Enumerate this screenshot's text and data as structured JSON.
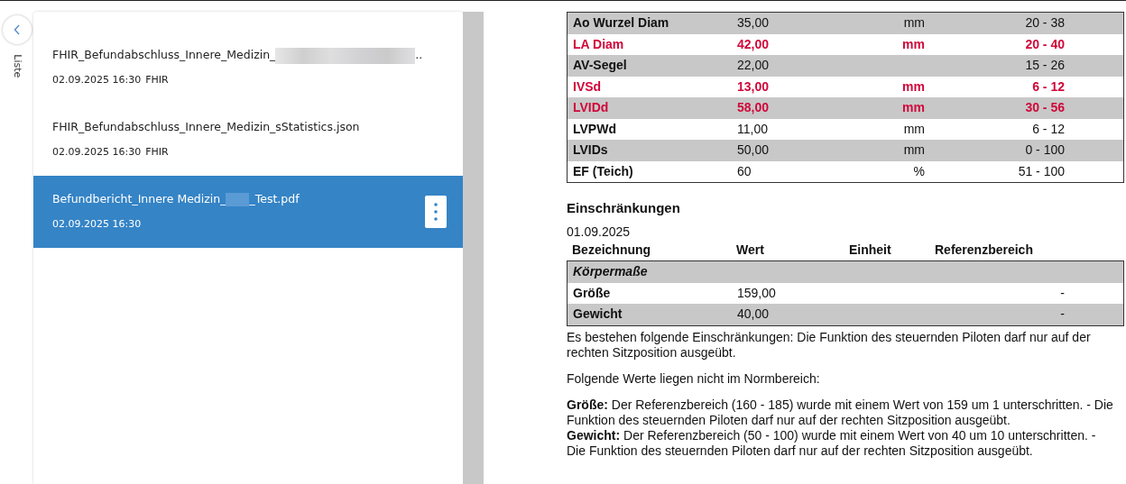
{
  "sidebar": {
    "back_label": "Liste"
  },
  "files": [
    {
      "title_parts": [
        "FHIR_Befundabschluss_Innere_Medizin_",
        ".."
      ],
      "date": "02.09.2025 16:30",
      "source": "FHIR",
      "selected": false
    },
    {
      "title_parts": [
        "FHIR_Befundabschluss_Innere_Medizin_sStatistics.json"
      ],
      "date": "02.09.2025 16:30",
      "source": "FHIR",
      "selected": false
    },
    {
      "title_parts": [
        "Befundbericht_Innere Medizin_",
        "_Test.pdf"
      ],
      "date": "02.09.2025 16:30",
      "selected": true
    }
  ],
  "measurements": [
    {
      "name": "Ao Wurzel Diam",
      "value": "35,00",
      "unit": "mm",
      "range": "20 - 38",
      "flagged": false
    },
    {
      "name": "LA Diam",
      "value": "42,00",
      "unit": "mm",
      "range": "20 - 40",
      "flagged": true
    },
    {
      "name": "AV-Segel",
      "value": "22,00",
      "range": "15 - 26",
      "flagged": false
    },
    {
      "name": "IVSd",
      "value": "13,00",
      "unit": "mm",
      "range": "6 - 12",
      "flagged": true
    },
    {
      "name": "LVIDd",
      "value": "58,00",
      "unit": "mm",
      "range": "30 - 56",
      "flagged": true
    },
    {
      "name": "LVPWd",
      "value": "11,00",
      "unit": "mm",
      "range": "6 - 12",
      "flagged": false
    },
    {
      "name": "LVIDs",
      "value": "50,00",
      "unit": "mm",
      "range": "0 - 100",
      "flagged": false
    },
    {
      "name": "EF (Teich)",
      "value": "60",
      "unit": "%",
      "range": "51 - 100",
      "flagged": false
    }
  ],
  "restrictions": {
    "heading": "Einschränkungen",
    "date": "01.09.2025",
    "columns": [
      "Bezeichnung",
      "Wert",
      "Einheit",
      "Referenzbereich"
    ],
    "rows": [
      {
        "kind": "group",
        "name": "Körpermaße"
      },
      {
        "kind": "row",
        "name": "Größe",
        "value": "159,00",
        "range": "-"
      },
      {
        "kind": "row",
        "name": "Gewicht",
        "value": "40,00",
        "range": "-"
      }
    ],
    "text": "Es bestehen folgende Einschränkungen: Die Funktion des steuernden Piloten darf nur auf der rechten Sitzposition ausgeübt.",
    "intro": "Folgende Werte liegen nicht im Normbereich:",
    "findings": [
      "**Größe:** Der Referenzbereich (160 - 185) wurde mit einem Wert von 159 um 1 unterschritten. - Die Funktion des steuernden Piloten darf nur auf der rechten Sitzposition ausgeübt.",
      "**Gewicht:** Der Referenzbereich (50 - 100) wurde mit einem Wert von 40 um 10 unterschritten. - Die Funktion des steuernden Piloten darf nur auf der rechten Sitzposition ausgeübt."
    ]
  }
}
